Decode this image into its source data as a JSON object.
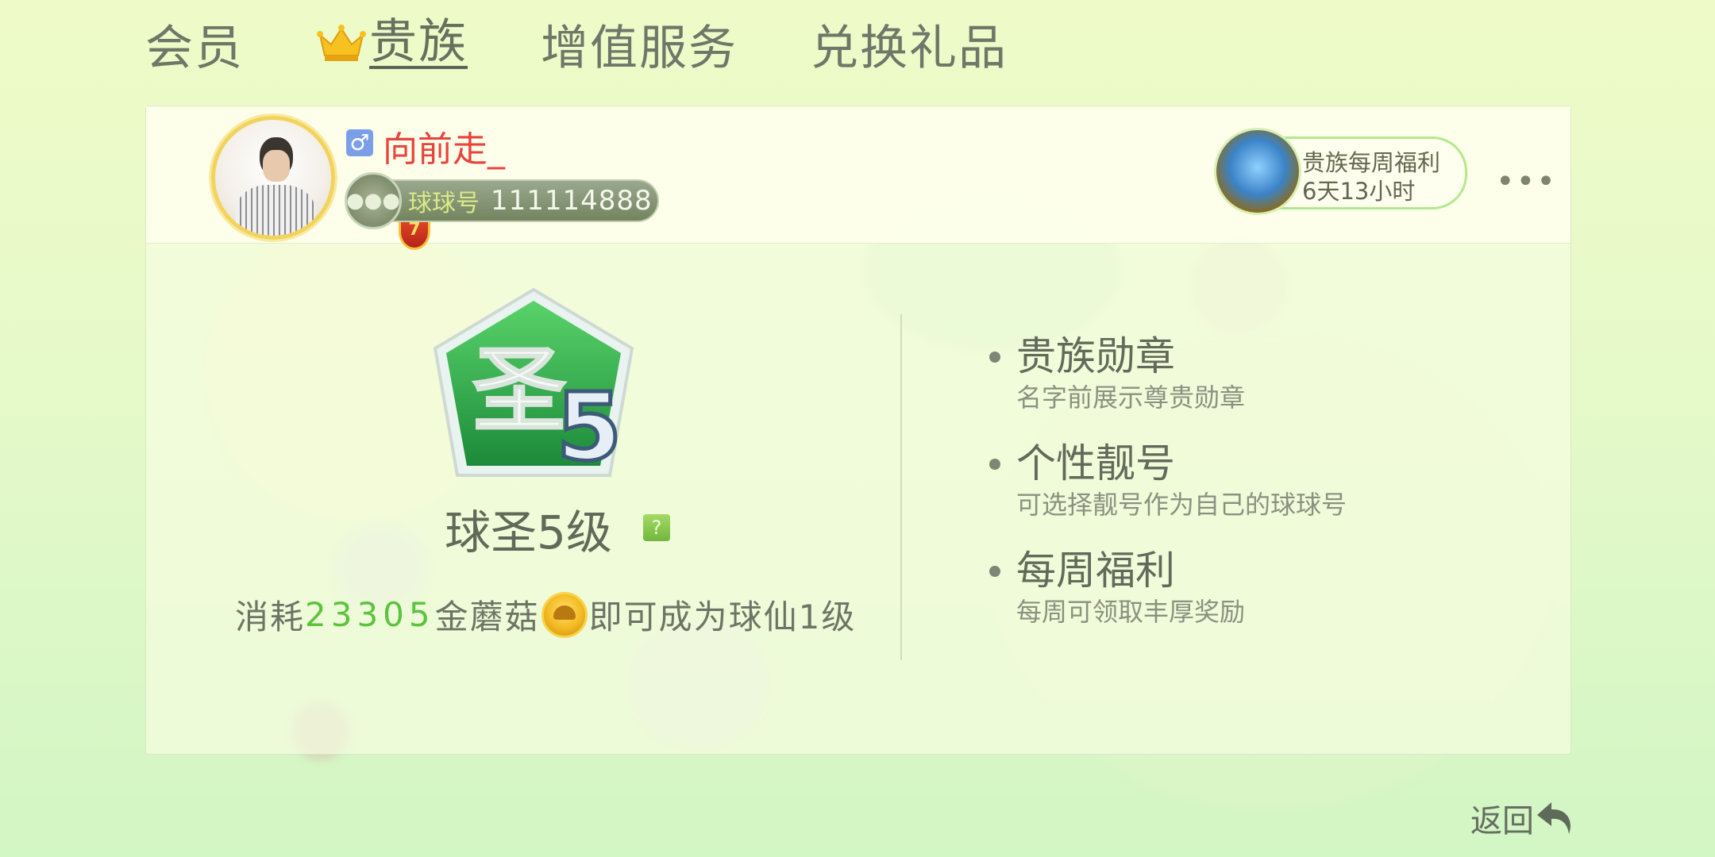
{
  "tabs": [
    {
      "label": "会员",
      "active": false
    },
    {
      "label": "贵族",
      "active": true
    },
    {
      "label": "增值服务",
      "active": false
    },
    {
      "label": "兑换礼品",
      "active": false
    }
  ],
  "profile": {
    "gender_symbol": "♂",
    "username": "向前走_",
    "level": "7",
    "id_label": "球球号",
    "id_number": "111114888"
  },
  "weekly_benefit": {
    "title": "贵族每周福利",
    "time_left": "6天13小时"
  },
  "more_label": "•••",
  "rank": {
    "emblem_char": "圣",
    "emblem_level": "5",
    "title": "球圣5级",
    "help": "?",
    "cost_prefix": "消耗",
    "cost_amount": "23305",
    "cost_currency": "金蘑菇",
    "cost_suffix": "即可成为球仙1级"
  },
  "perks": [
    {
      "title": "贵族勋章",
      "desc": "名字前展示尊贵勋章"
    },
    {
      "title": "个性靓号",
      "desc": "可选择靓号作为自己的球球号"
    },
    {
      "title": "每周福利",
      "desc": "每周可领取丰厚奖励"
    }
  ],
  "back_label": "返回",
  "colors": {
    "accent_green": "#5cc33c",
    "username_red": "#e8433c",
    "emblem_green": "#2fa34a"
  }
}
